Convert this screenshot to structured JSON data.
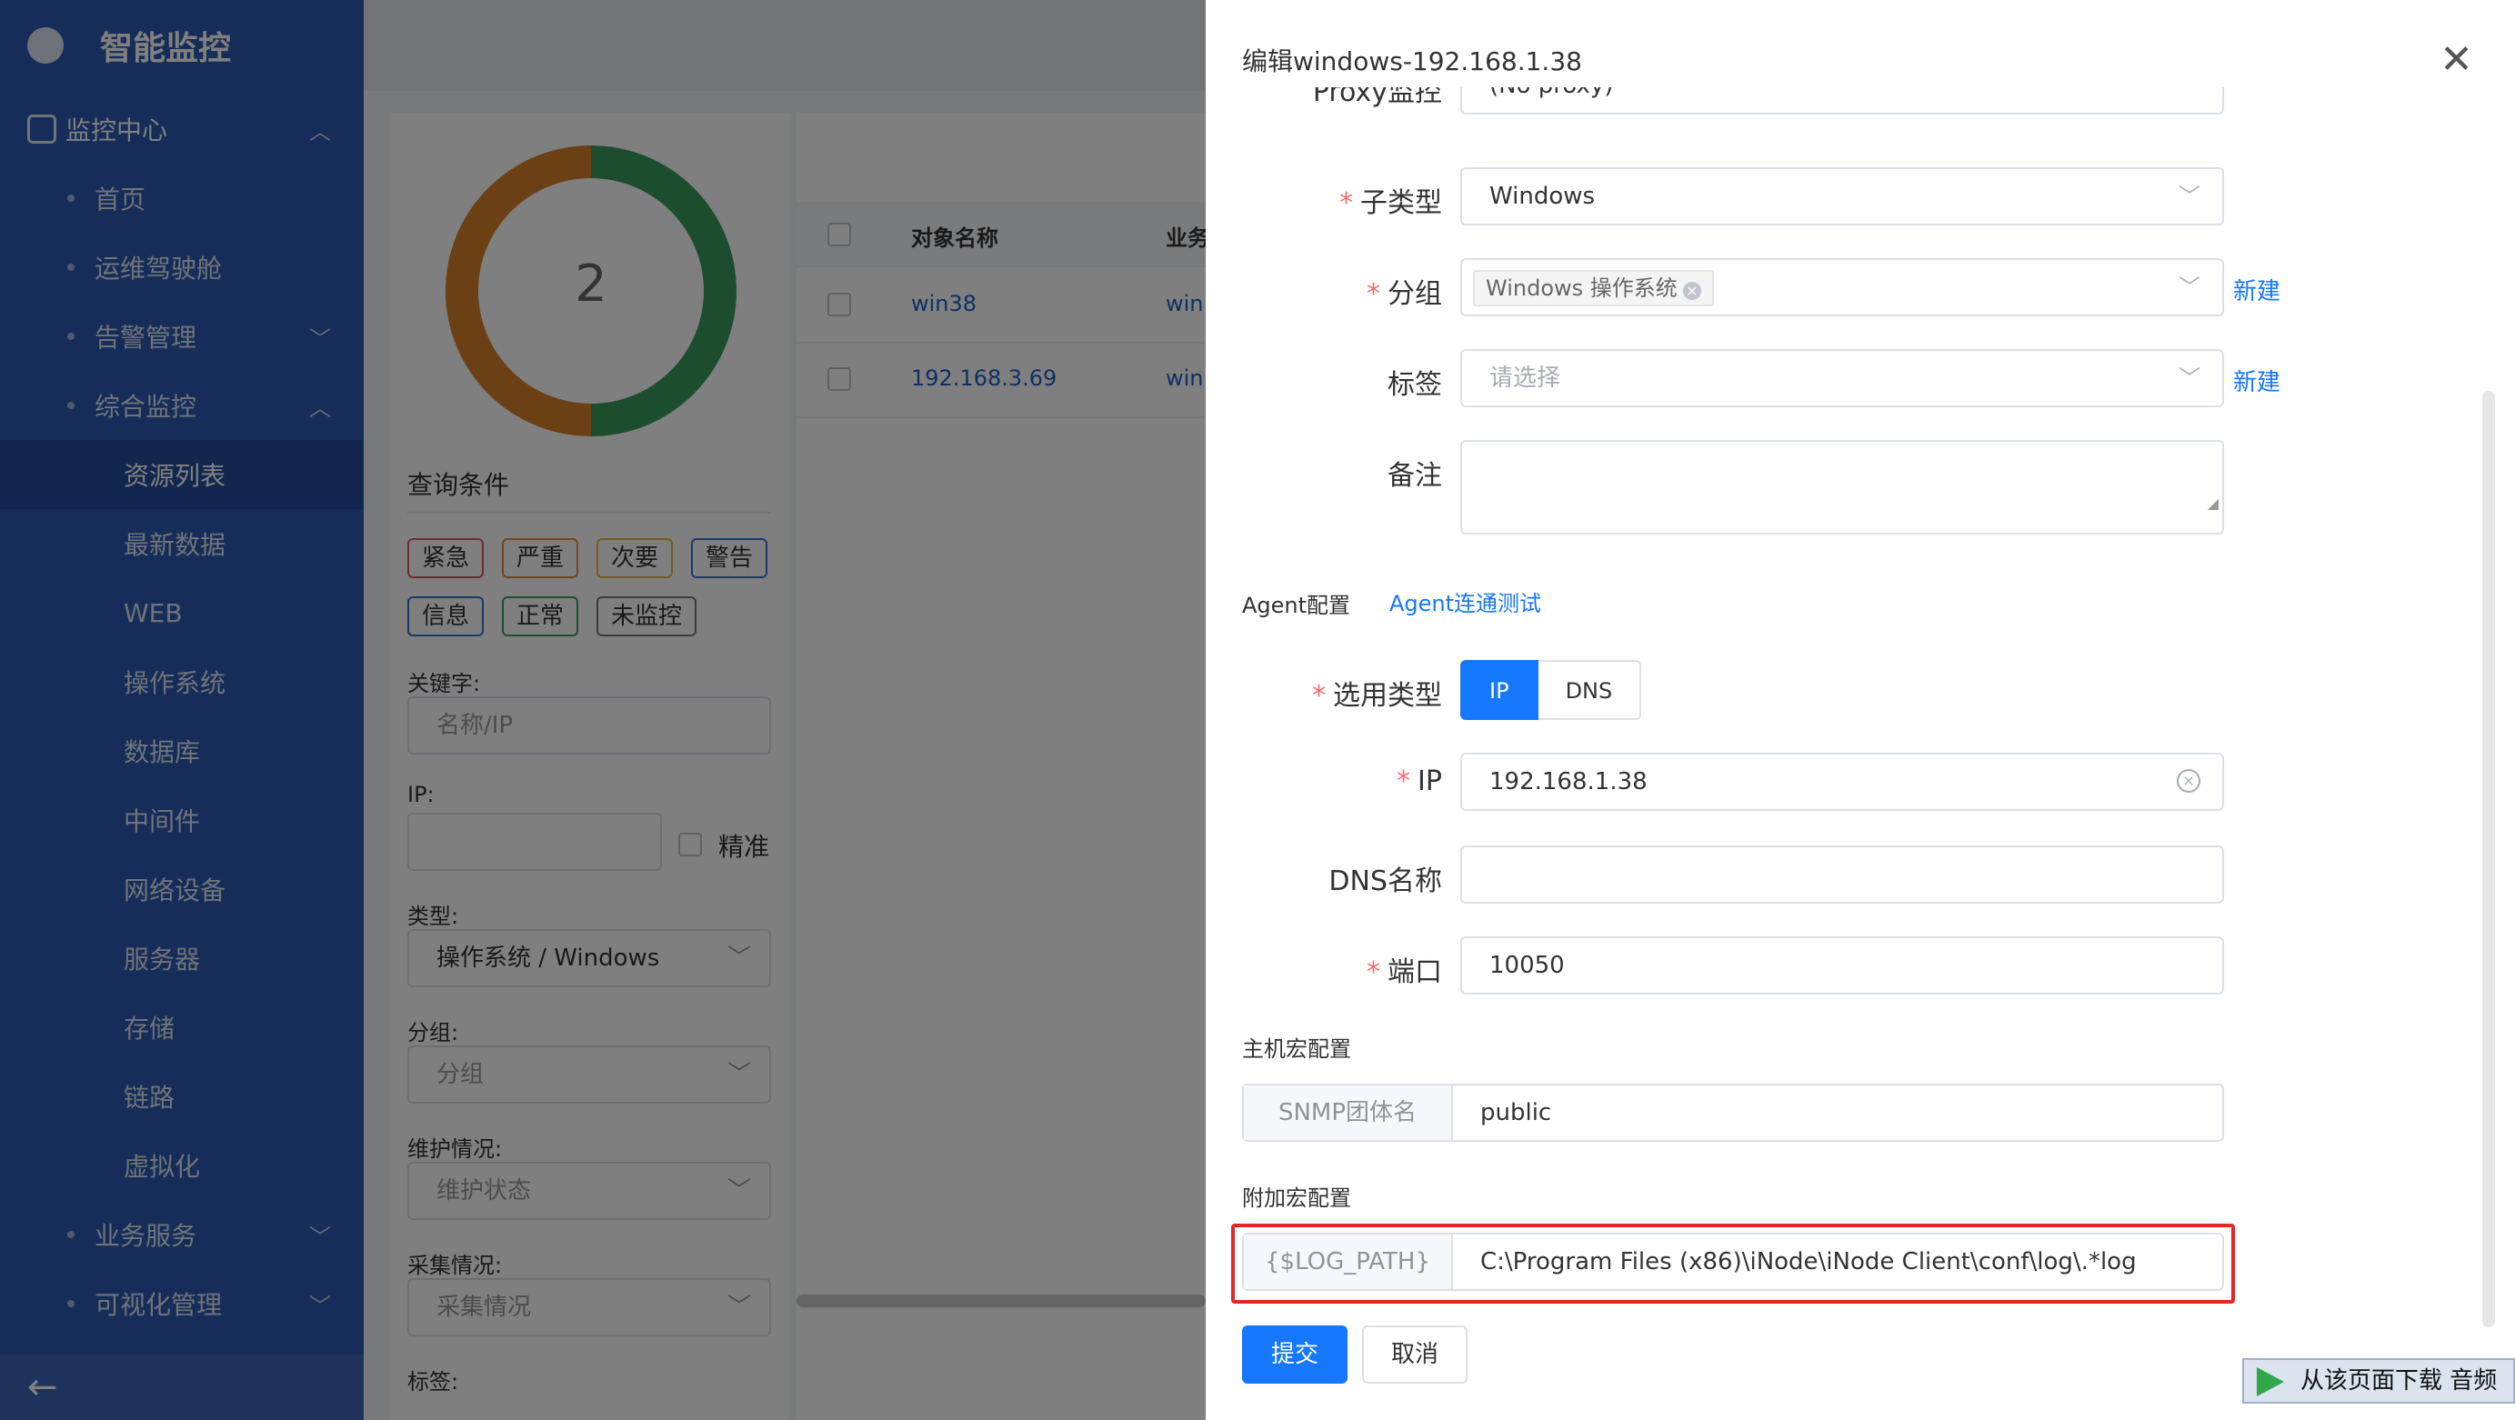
{
  "app": {
    "title": "智能监控"
  },
  "sidebar": {
    "top": "监控中心",
    "items": [
      {
        "label": "首页"
      },
      {
        "label": "运维驾驶舱"
      },
      {
        "label": "告警管理"
      },
      {
        "label": "综合监控"
      }
    ],
    "subitems": [
      {
        "label": "资源列表"
      },
      {
        "label": "最新数据"
      },
      {
        "label": "WEB"
      },
      {
        "label": "操作系统"
      },
      {
        "label": "数据库"
      },
      {
        "label": "中间件"
      },
      {
        "label": "网络设备"
      },
      {
        "label": "服务器"
      },
      {
        "label": "存储"
      },
      {
        "label": "链路"
      },
      {
        "label": "虚拟化"
      }
    ],
    "bottom_items": [
      {
        "label": "业务服务"
      },
      {
        "label": "可视化管理"
      }
    ],
    "collapse_icon": "arrow-left-icon"
  },
  "background": {
    "donut_count": "2",
    "query_title": "查询条件",
    "tags": [
      "紧急",
      "严重",
      "次要",
      "警告",
      "信息",
      "正常",
      "未监控"
    ],
    "keyword_label": "关键字:",
    "keyword_placeholder": "名称/IP",
    "ip_label": "IP:",
    "exact_label": "精准",
    "type_label": "类型:",
    "type_value": "操作系统 / Windows",
    "group_label": "分组:",
    "group_placeholder": "分组",
    "maint_label": "维护情况:",
    "maint_placeholder": "维护状态",
    "collect_label": "采集情况:",
    "collect_placeholder": "采集情况",
    "tag_label": "标签:",
    "table": {
      "col_name": "对象名称",
      "col_biz": "业务",
      "rows": [
        {
          "name": "win38",
          "biz": "win"
        },
        {
          "name": "192.168.3.69",
          "biz": "win"
        }
      ]
    }
  },
  "drawer": {
    "title": "编辑windows-192.168.1.38",
    "proxy_label": "Proxy监控",
    "proxy_value": "(No proxy)",
    "subtype_label": "子类型",
    "subtype_value": "Windows",
    "group_label": "分组",
    "group_chip": "Windows 操作系统",
    "group_new": "新建",
    "tag_label": "标签",
    "tag_placeholder": "请选择",
    "tag_new": "新建",
    "remark_label": "备注",
    "agent_section": "Agent配置",
    "agent_test": "Agent连通测试",
    "select_type_label": "选用类型",
    "select_type_options": [
      "IP",
      "DNS"
    ],
    "ip_label": "IP",
    "ip_value": "192.168.1.38",
    "dns_label": "DNS名称",
    "port_label": "端口",
    "port_value": "10050",
    "host_macro_section": "主机宏配置",
    "snmp_label": "SNMP团体名",
    "snmp_value": "public",
    "extra_macro_section": "附加宏配置",
    "log_macro_name": "{$LOG_PATH}",
    "log_macro_value": "C:\\Program Files (x86)\\iNode\\iNode Client\\conf\\log\\.*log",
    "submit": "提交",
    "cancel": "取消"
  },
  "download_badge": "从该页面下载 音频"
}
